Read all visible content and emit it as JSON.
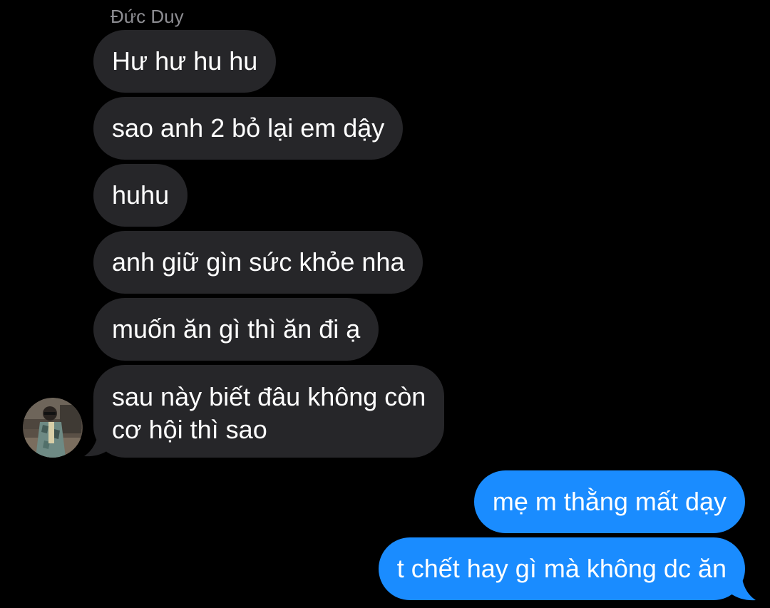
{
  "conversation": {
    "sender_name": "Đức Duy",
    "incoming": [
      {
        "text": "Hư hư hu hu"
      },
      {
        "text": "sao anh 2 bỏ lại em dậy"
      },
      {
        "text": "huhu"
      },
      {
        "text": "anh giữ gìn sức khỏe nha"
      },
      {
        "text": "muốn ăn gì thì ăn đi ạ"
      },
      {
        "line1": "sau này biết đâu không còn",
        "line2": "cơ hội thì sao"
      }
    ],
    "outgoing": [
      {
        "text": "mẹ m thằng mất dạy"
      },
      {
        "text": "t chết hay gì mà không dc ăn"
      }
    ]
  },
  "colors": {
    "background": "#000000",
    "incoming_bubble": "#262629",
    "outgoing_bubble": "#1a8cff",
    "sender_name": "#8e8e93"
  },
  "icons": {
    "avatar": "avatar-photo"
  }
}
